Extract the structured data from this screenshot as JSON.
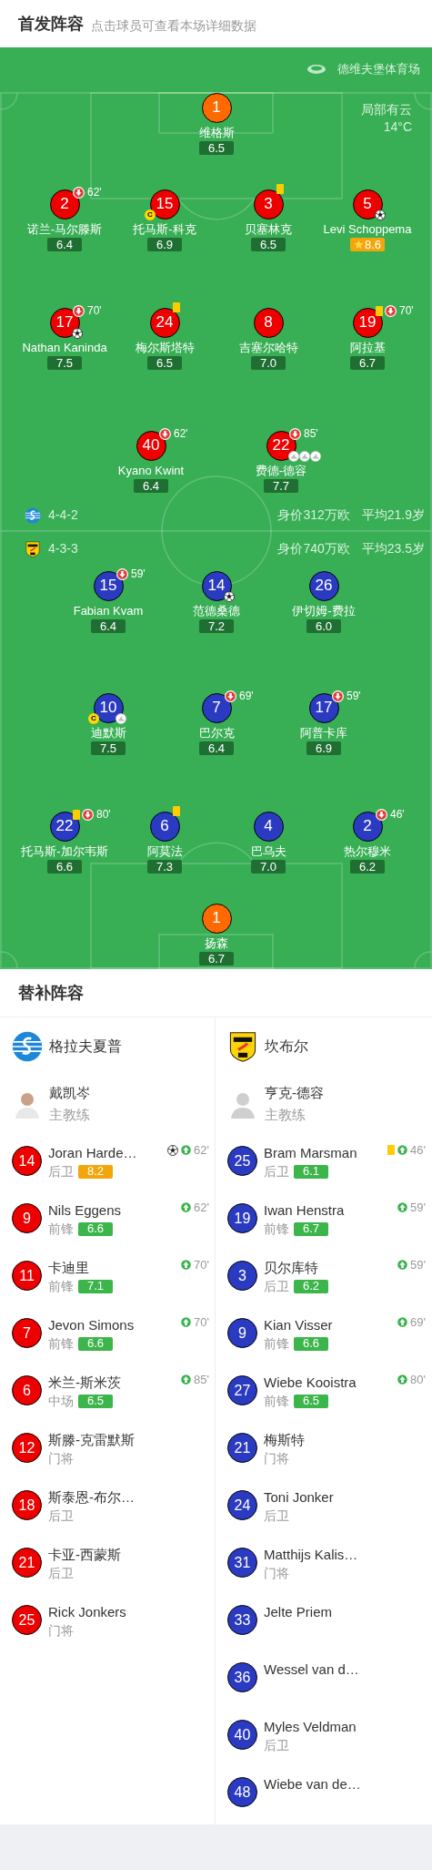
{
  "header": {
    "title": "首发阵容",
    "subtitle": "点击球员可查看本场详细数据"
  },
  "pitch": {
    "stadium": "德维夫堡体育场",
    "weather": "局部有云",
    "temperature": "14°C",
    "home": {
      "formation": "4-4-2",
      "value": "身价312万欧",
      "age": "平均21.9岁",
      "color": "#ee0000",
      "lines": [
        [
          {
            "number": "1",
            "name": "维格斯",
            "rating": "6.5",
            "kind": "goalkeeper",
            "top": false
          }
        ],
        [
          {
            "number": "2",
            "name": "诺兰-马尔滕斯",
            "rating": "6.4",
            "kind": "outfield",
            "top": false,
            "events": [
              {
                "kind": "sub_out",
                "minute": "62'"
              }
            ]
          },
          {
            "number": "15",
            "name": "托马斯-科克",
            "rating": "6.9",
            "kind": "outfield",
            "top": false,
            "events": [
              {
                "kind": "captain",
                "label": "C"
              }
            ]
          },
          {
            "number": "3",
            "name": "贝塞林克",
            "rating": "6.5",
            "kind": "outfield",
            "top": false,
            "events": [
              {
                "kind": "yellow_card"
              }
            ]
          },
          {
            "number": "5",
            "name": "Levi Schoppema",
            "rating": "8.6",
            "kind": "outfield",
            "top": true,
            "events": [
              {
                "kind": "goal"
              }
            ]
          }
        ],
        [
          {
            "number": "17",
            "name": "Nathan Kaninda",
            "rating": "7.5",
            "kind": "outfield",
            "top": false,
            "events": [
              {
                "kind": "sub_out",
                "minute": "70'"
              },
              {
                "kind": "goal"
              }
            ]
          },
          {
            "number": "24",
            "name": "梅尔斯塔特",
            "rating": "6.5",
            "kind": "outfield",
            "top": false,
            "events": [
              {
                "kind": "yellow_card"
              }
            ]
          },
          {
            "number": "8",
            "name": "吉塞尔哈特",
            "rating": "7.0",
            "kind": "outfield",
            "top": false
          },
          {
            "number": "19",
            "name": "阿拉基",
            "rating": "6.7",
            "kind": "outfield",
            "top": false,
            "events": [
              {
                "kind": "yellow_card"
              },
              {
                "kind": "sub_out",
                "minute": "70'"
              }
            ]
          }
        ],
        [
          {
            "number": "40",
            "name": "Kyano Kwint",
            "rating": "6.4",
            "kind": "outfield",
            "top": false,
            "events": [
              {
                "kind": "sub_out",
                "minute": "62'"
              }
            ]
          },
          {
            "number": "22",
            "name": "费德-德容",
            "rating": "7.7",
            "kind": "outfield",
            "top": false,
            "events": [
              {
                "kind": "sub_out",
                "minute": "85'"
              },
              {
                "kind": "assist"
              },
              {
                "kind": "assist"
              },
              {
                "kind": "assist"
              }
            ]
          }
        ]
      ]
    },
    "away": {
      "formation": "4-3-3",
      "value": "身价740万欧",
      "age": "平均23.5岁",
      "color": "#2a3bc2",
      "lines": [
        [
          {
            "number": "15",
            "name": "Fabian Kvam",
            "rating": "6.4",
            "kind": "outfield",
            "top": false,
            "events": [
              {
                "kind": "sub_out",
                "minute": "59'"
              }
            ]
          },
          {
            "number": "14",
            "name": "范德桑德",
            "rating": "7.2",
            "kind": "outfield",
            "top": false,
            "events": [
              {
                "kind": "goal"
              }
            ]
          },
          {
            "number": "26",
            "name": "伊切姆-费拉",
            "rating": "6.0",
            "kind": "outfield",
            "top": false
          }
        ],
        [
          {
            "number": "10",
            "name": "迪默斯",
            "rating": "7.5",
            "kind": "outfield",
            "top": false,
            "events": [
              {
                "kind": "captain",
                "label": "C"
              },
              {
                "kind": "assist"
              }
            ]
          },
          {
            "number": "7",
            "name": "巴尔克",
            "rating": "6.4",
            "kind": "outfield",
            "top": false,
            "events": [
              {
                "kind": "sub_out",
                "minute": "69'"
              }
            ]
          },
          {
            "number": "17",
            "name": "阿普卡库",
            "rating": "6.9",
            "kind": "outfield",
            "top": false,
            "events": [
              {
                "kind": "sub_out",
                "minute": "59'"
              }
            ]
          }
        ],
        [
          {
            "number": "22",
            "name": "托马斯-加尔韦斯",
            "rating": "6.6",
            "kind": "outfield",
            "top": false,
            "events": [
              {
                "kind": "yellow_card"
              },
              {
                "kind": "sub_out",
                "minute": "80'"
              }
            ]
          },
          {
            "number": "6",
            "name": "阿莫法",
            "rating": "7.3",
            "kind": "outfield",
            "top": false,
            "events": [
              {
                "kind": "yellow_card"
              }
            ]
          },
          {
            "number": "4",
            "name": "巴乌夫",
            "rating": "7.0",
            "kind": "outfield",
            "top": false
          },
          {
            "number": "2",
            "name": "热尔穆米",
            "rating": "6.2",
            "kind": "outfield",
            "top": false,
            "events": [
              {
                "kind": "sub_out",
                "minute": "46'"
              }
            ]
          }
        ],
        [
          {
            "number": "1",
            "name": "扬森",
            "rating": "6.7",
            "kind": "goalkeeper",
            "top": false
          }
        ]
      ]
    }
  },
  "substitutes": {
    "title": "替补阵容",
    "teams": [
      {
        "team": "格拉夫夏普",
        "coach": "戴凯岑",
        "coach_role": "主教练",
        "color": "#ee0000",
        "players": [
          {
            "number": "14",
            "name": "Joran Harde…",
            "position": "后卫",
            "rating": "8.2",
            "top": true,
            "events": [
              {
                "kind": "goal"
              },
              {
                "kind": "sub_in",
                "minute": "62'"
              }
            ]
          },
          {
            "number": "9",
            "name": "Nils Eggens",
            "position": "前锋",
            "rating": "6.6",
            "top": false,
            "events": [
              {
                "kind": "sub_in",
                "minute": "62'"
              }
            ]
          },
          {
            "number": "11",
            "name": "卡迪里",
            "position": "前锋",
            "rating": "7.1",
            "top": false,
            "events": [
              {
                "kind": "sub_in",
                "minute": "70'"
              }
            ]
          },
          {
            "number": "7",
            "name": "Jevon Simons",
            "position": "前锋",
            "rating": "6.6",
            "top": false,
            "events": [
              {
                "kind": "sub_in",
                "minute": "70'"
              }
            ]
          },
          {
            "number": "6",
            "name": "米兰-斯米茨",
            "position": "中场",
            "rating": "6.5",
            "top": false,
            "events": [
              {
                "kind": "sub_in",
                "minute": "85'"
              }
            ]
          },
          {
            "number": "12",
            "name": "斯滕-克雷默斯",
            "position": "门将"
          },
          {
            "number": "18",
            "name": "斯泰恩-布尔…",
            "position": "后卫"
          },
          {
            "number": "21",
            "name": "卡亚-西蒙斯",
            "position": "后卫"
          },
          {
            "number": "25",
            "name": "Rick Jonkers",
            "position": "门将"
          }
        ]
      },
      {
        "team": "坎布尔",
        "coach": "亨克-德容",
        "coach_role": "主教练",
        "color": "#2a3bc2",
        "players": [
          {
            "number": "25",
            "name": "Bram Marsman",
            "position": "后卫",
            "rating": "6.1",
            "top": false,
            "events": [
              {
                "kind": "yellow_card"
              },
              {
                "kind": "sub_in",
                "minute": "46'"
              }
            ]
          },
          {
            "number": "19",
            "name": "Iwan Henstra",
            "position": "前锋",
            "rating": "6.7",
            "top": false,
            "events": [
              {
                "kind": "sub_in",
                "minute": "59'"
              }
            ]
          },
          {
            "number": "3",
            "name": "贝尔库特",
            "position": "后卫",
            "rating": "6.2",
            "top": false,
            "events": [
              {
                "kind": "sub_in",
                "minute": "59'"
              }
            ]
          },
          {
            "number": "9",
            "name": "Kian Visser",
            "position": "前锋",
            "rating": "6.6",
            "top": false,
            "events": [
              {
                "kind": "sub_in",
                "minute": "69'"
              }
            ]
          },
          {
            "number": "27",
            "name": "Wiebe Kooistra",
            "position": "前锋",
            "rating": "6.5",
            "top": false,
            "events": [
              {
                "kind": "sub_in",
                "minute": "80'"
              }
            ]
          },
          {
            "number": "21",
            "name": "梅斯特",
            "position": "门将"
          },
          {
            "number": "24",
            "name": "Toni Jonker",
            "position": "后卫"
          },
          {
            "number": "31",
            "name": "Matthijs Kalis…",
            "position": "门将"
          },
          {
            "number": "33",
            "name": "Jelte Priem"
          },
          {
            "number": "36",
            "name": "Wessel van d…"
          },
          {
            "number": "40",
            "name": "Myles Veldman",
            "position": "后卫"
          },
          {
            "number": "48",
            "name": "Wiebe van de…"
          }
        ]
      }
    ]
  }
}
